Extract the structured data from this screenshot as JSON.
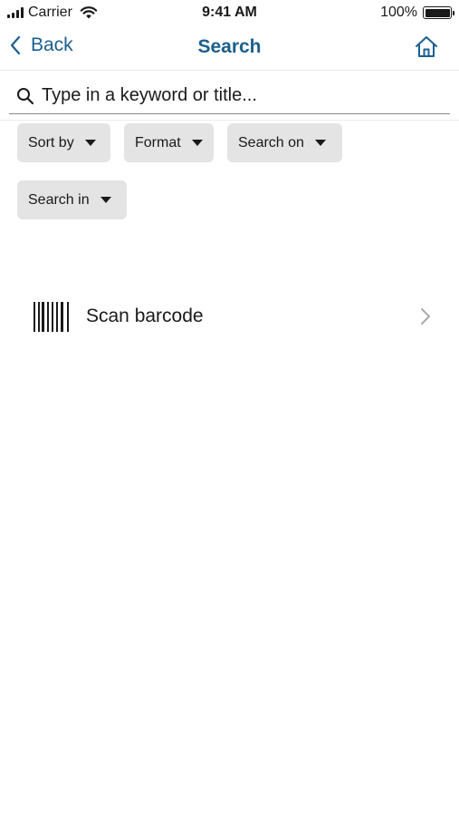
{
  "status_bar": {
    "carrier": "Carrier",
    "time": "9:41 AM",
    "battery": "100%",
    "battery_level": 1.0
  },
  "nav": {
    "back_label": "Back",
    "title": "Search",
    "home_icon": "home-icon"
  },
  "search": {
    "placeholder": "Type in a keyword or title...",
    "value": ""
  },
  "filters": [
    {
      "label": "Sort by"
    },
    {
      "label": "Format"
    },
    {
      "label": "Search on"
    },
    {
      "label": "Search in"
    }
  ],
  "scan": {
    "label": "Scan barcode",
    "icon": "barcode-icon"
  },
  "colors": {
    "accent": "#1a5f8e",
    "chip_bg": "#e4e4e4"
  }
}
